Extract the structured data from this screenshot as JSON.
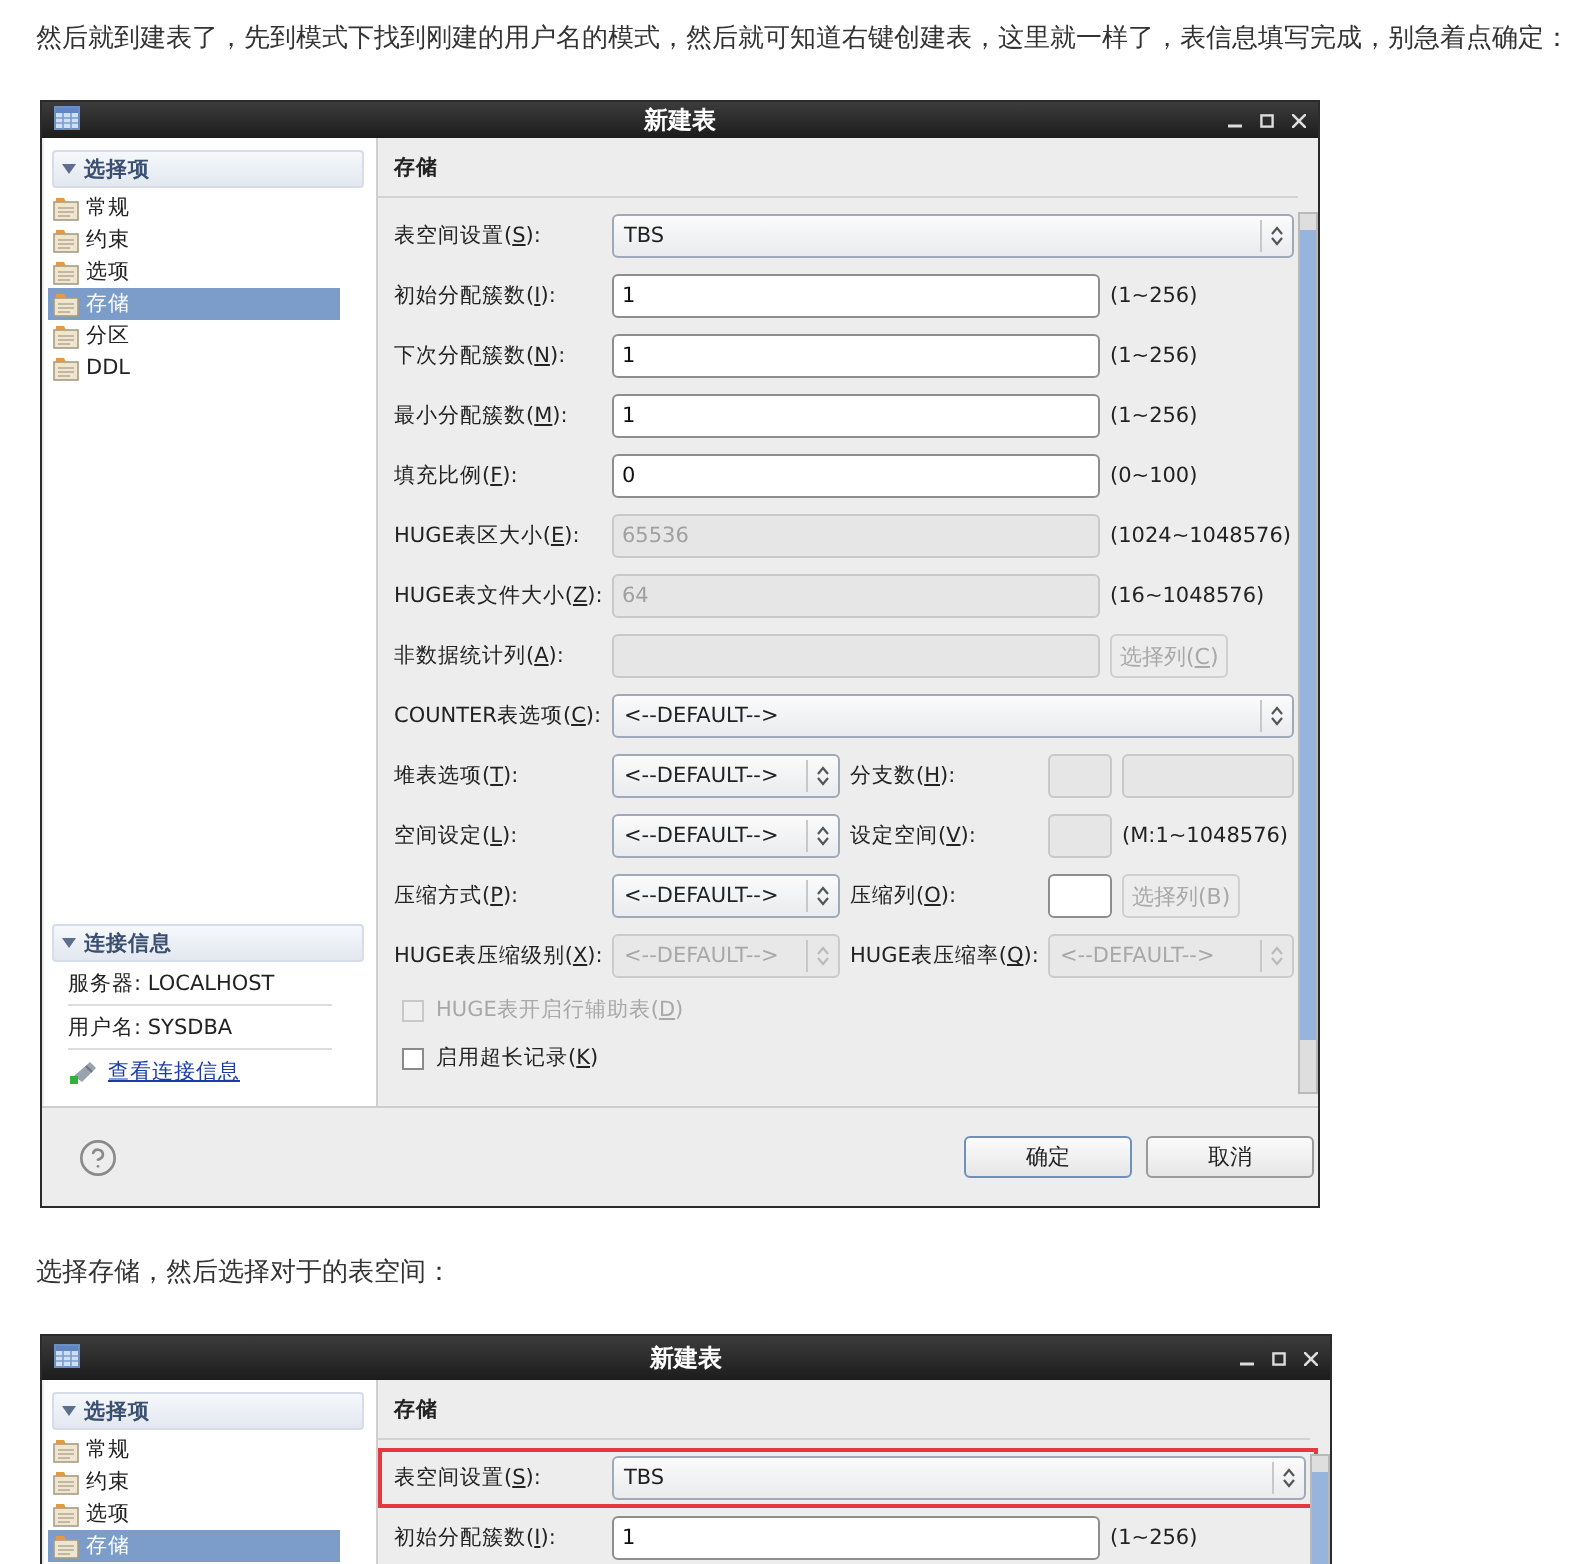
{
  "blocks": [
    {
      "kind": "paragraph",
      "text": "然后就到建表了，先到模式下找到刚建的用户名的模式，然后就可知道右键创建表，这里就一样了，表信息填写完成，别急着点确定："
    },
    {
      "kind": "dialog",
      "title": "新建表",
      "sidebar": {
        "header": "选择项",
        "items": [
          {
            "label": "常规",
            "selected": false
          },
          {
            "label": "约束",
            "selected": false
          },
          {
            "label": "选项",
            "selected": false
          },
          {
            "label": "存储",
            "selected": true
          },
          {
            "label": "分区",
            "selected": false
          },
          {
            "label": "DDL",
            "selected": false
          }
        ]
      },
      "connection": {
        "header": "连接信息",
        "lines": [
          "服务器: LOCALHOST",
          "用户名: SYSDBA"
        ],
        "link": "查看连接信息"
      },
      "section": "存储",
      "rows": [
        {
          "kind": "wide",
          "label": [
            "表空间设置(",
            "S",
            "):"
          ],
          "controls": [
            {
              "kind": "select",
              "value": "TBS",
              "disabled": false
            }
          ]
        },
        {
          "kind": "wide",
          "label": [
            "初始分配簇数(",
            "I",
            "):"
          ],
          "controls": [
            {
              "kind": "field",
              "value": "1",
              "disabled": false
            },
            {
              "kind": "hint",
              "text": "(1~256)"
            }
          ]
        },
        {
          "kind": "wide",
          "label": [
            "下次分配簇数(",
            "N",
            "):"
          ],
          "controls": [
            {
              "kind": "field",
              "value": "1",
              "disabled": false
            },
            {
              "kind": "hint",
              "text": "(1~256)"
            }
          ]
        },
        {
          "kind": "wide",
          "label": [
            "最小分配簇数(",
            "M",
            "):"
          ],
          "controls": [
            {
              "kind": "field",
              "value": "1",
              "disabled": false
            },
            {
              "kind": "hint",
              "text": "(1~256)"
            }
          ]
        },
        {
          "kind": "wide",
          "label": [
            "填充比例(",
            "F",
            "):"
          ],
          "controls": [
            {
              "kind": "field",
              "value": "0",
              "disabled": false
            },
            {
              "kind": "hint",
              "text": "(0~100)"
            }
          ]
        },
        {
          "kind": "wide",
          "label": [
            "HUGE表区大小(",
            "E",
            "):"
          ],
          "controls": [
            {
              "kind": "field",
              "value": "65536",
              "disabled": true
            },
            {
              "kind": "hint",
              "text": "(1024~1048576)"
            }
          ]
        },
        {
          "kind": "wide",
          "label": [
            "HUGE表文件大小(",
            "Z",
            "):"
          ],
          "controls": [
            {
              "kind": "field",
              "value": "64",
              "disabled": true
            },
            {
              "kind": "hint",
              "text": "(16~1048576)"
            }
          ]
        },
        {
          "kind": "wide",
          "label": [
            "非数据统计列(",
            "A",
            "):"
          ],
          "controls": [
            {
              "kind": "field",
              "disabled": true
            },
            {
              "kind": "button",
              "label": [
                "选择列(",
                "C",
                ")"
              ],
              "disabled": true
            }
          ]
        },
        {
          "kind": "wide",
          "label": [
            "COUNTER表选项(",
            "C",
            "):"
          ],
          "controls": [
            {
              "kind": "select",
              "value": "<--DEFAULT-->",
              "disabled": false
            }
          ]
        },
        {
          "kind": "split",
          "label": [
            "堆表选项(",
            "T",
            "):"
          ],
          "controls": [
            {
              "kind": "select",
              "value": "<--DEFAULT-->",
              "disabled": false
            },
            {
              "kind": "label",
              "text": [
                "分支数(",
                "H",
                "):"
              ]
            },
            {
              "kind": "field",
              "disabled": true
            },
            {
              "kind": "field",
              "disabled": true
            }
          ]
        },
        {
          "kind": "split",
          "label": [
            "空间设定(",
            "L",
            "):"
          ],
          "controls": [
            {
              "kind": "select",
              "value": "<--DEFAULT-->",
              "disabled": false
            },
            {
              "kind": "label",
              "text": [
                "设定空间(",
                "V",
                "):"
              ]
            },
            {
              "kind": "field",
              "disabled": true
            },
            {
              "kind": "hint",
              "text": "(M:1~1048576)"
            }
          ]
        },
        {
          "kind": "split",
          "label": [
            "压缩方式(",
            "P",
            "):"
          ],
          "controls": [
            {
              "kind": "select",
              "value": "<--DEFAULT-->",
              "disabled": false
            },
            {
              "kind": "label",
              "text": [
                "压缩列(",
                "O",
                "):"
              ]
            },
            {
              "kind": "field",
              "disabled": false
            },
            {
              "kind": "button",
              "label": [
                "选择列(B)"
              ],
              "disabled": true
            }
          ]
        },
        {
          "kind": "split",
          "label": [
            "HUGE表压缩级别(",
            "X",
            "):"
          ],
          "controls": [
            {
              "kind": "select",
              "value": "<--DEFAULT-->",
              "disabled": true
            },
            {
              "kind": "label",
              "text": [
                "HUGE表压缩率(",
                "Q",
                "):"
              ]
            },
            {
              "kind": "select",
              "value": "<--DEFAULT-->",
              "disabled": true
            }
          ]
        }
      ],
      "checkboxes": [
        {
          "label": [
            "HUGE表开启行辅助表(",
            "D",
            ")"
          ],
          "checked": false,
          "disabled": true
        },
        {
          "label": [
            "启用超长记录(",
            "K",
            ")"
          ],
          "checked": false,
          "disabled": false
        }
      ],
      "buttons": [
        {
          "label": "确定",
          "default": true
        },
        {
          "label": "取消",
          "default": false
        }
      ]
    },
    {
      "kind": "paragraph",
      "text": "选择存储，然后选择对于的表空间："
    },
    {
      "kind": "dialog",
      "title": "新建表",
      "sidebar": {
        "header": "选择项",
        "items": [
          {
            "label": "常规",
            "selected": false
          },
          {
            "label": "约束",
            "selected": false
          },
          {
            "label": "选项",
            "selected": false
          },
          {
            "label": "存储",
            "selected": true
          }
        ]
      },
      "section": "存储",
      "rows": [
        {
          "kind": "wide",
          "highlighted": true,
          "label": [
            "表空间设置(",
            "S",
            "):"
          ],
          "controls": [
            {
              "kind": "select",
              "value": "TBS",
              "disabled": false
            }
          ]
        },
        {
          "kind": "wide",
          "highlighted": false,
          "label": [
            "初始分配簇数(",
            "I",
            "):"
          ],
          "controls": [
            {
              "kind": "field",
              "value": "1",
              "disabled": false
            },
            {
              "kind": "hint",
              "text": "(1~256)"
            }
          ]
        }
      ]
    }
  ]
}
